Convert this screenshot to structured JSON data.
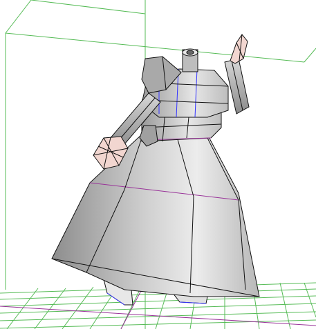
{
  "viewport": {
    "background_color": "#ffffff",
    "grid_color": "#55bb55",
    "selected_edge_color": "#993399",
    "highlight_edge_color": "#3333ff",
    "model_outline_color": "#111111",
    "skin_tone_color": "#f2d6d0",
    "garment_color": "#cfcfcf"
  }
}
